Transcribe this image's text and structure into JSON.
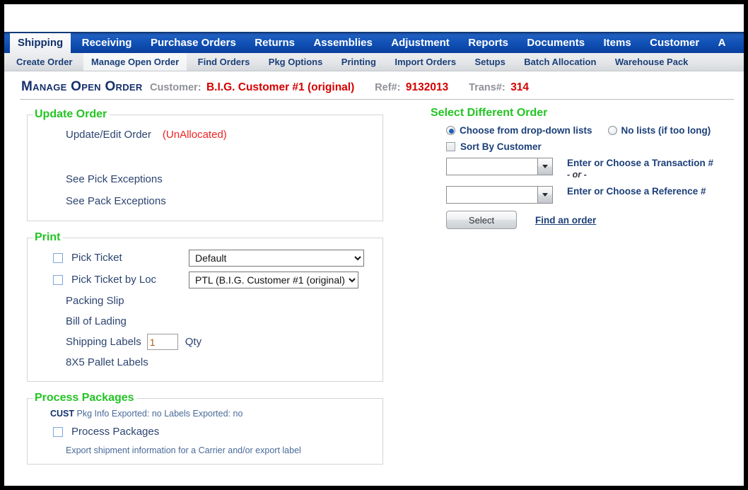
{
  "mainnav": {
    "tabs": [
      {
        "label": "Shipping",
        "active": true
      },
      {
        "label": "Receiving",
        "active": false
      },
      {
        "label": "Purchase Orders",
        "active": false
      },
      {
        "label": "Returns",
        "active": false
      },
      {
        "label": "Assemblies",
        "active": false
      },
      {
        "label": "Adjustment",
        "active": false
      },
      {
        "label": "Reports",
        "active": false
      },
      {
        "label": "Documents",
        "active": false
      },
      {
        "label": "Items",
        "active": false
      },
      {
        "label": "Customer",
        "active": false
      },
      {
        "label": "A",
        "active": false
      }
    ]
  },
  "subnav": {
    "tabs": [
      {
        "label": "Create Order",
        "active": false
      },
      {
        "label": "Manage Open Order",
        "active": true
      },
      {
        "label": "Find Orders",
        "active": false
      },
      {
        "label": "Pkg Options",
        "active": false
      },
      {
        "label": "Printing",
        "active": false
      },
      {
        "label": "Import Orders",
        "active": false
      },
      {
        "label": "Setups",
        "active": false
      },
      {
        "label": "Batch Allocation",
        "active": false
      },
      {
        "label": "Warehouse Pack",
        "active": false
      }
    ]
  },
  "heading": {
    "title": "Manage Open Order",
    "customer_label": "Customer:",
    "customer_value": "B.I.G. Customer #1 (original)",
    "ref_label": "Ref#:",
    "ref_value": "9132013",
    "trans_label": "Trans#:",
    "trans_value": "314"
  },
  "update_order": {
    "legend": "Update Order",
    "edit_link": "Update/Edit Order",
    "status": "(UnAllocated)",
    "pick_exceptions": "See Pick Exceptions",
    "pack_exceptions": "See Pack Exceptions"
  },
  "print": {
    "legend": "Print",
    "pick_ticket_label": "Pick Ticket",
    "pick_ticket_select": "Default",
    "pick_ticket_loc_label": "Pick Ticket by Loc",
    "pick_ticket_loc_select": "PTL (B.I.G. Customer #1 (original))",
    "packing_slip": "Packing Slip",
    "bill_of_lading": "Bill of Lading",
    "shipping_labels": "Shipping Labels",
    "shipping_labels_qty": "1",
    "qty_label": "Qty",
    "pallet_labels": "8X5 Pallet Labels"
  },
  "process_packages": {
    "legend": "Process Packages",
    "cust_tag": "CUST",
    "status_line": "Pkg Info Exported: no Labels Exported: no",
    "checkbox_label": "Process Packages",
    "description": "Export shipment information for a Carrier and/or export label"
  },
  "select_order": {
    "title": "Select Different Order",
    "radio_dropdown": "Choose from drop-down lists",
    "radio_nolists": "No lists (if too long)",
    "checkbox_sort": "Sort By Customer",
    "transaction_value": "",
    "transaction_placeholder": "",
    "transaction_hint": "Enter or Choose a Transaction #",
    "or_text": "- or -",
    "reference_value": "",
    "reference_placeholder": "",
    "reference_hint": "Enter or Choose a Reference #",
    "select_button": "Select",
    "find_link": "Find an order"
  },
  "colors": {
    "nav_blue": "#0f4fb4",
    "legend_green": "#23c423",
    "value_red": "#d40000",
    "link_navy": "#2d4470"
  }
}
